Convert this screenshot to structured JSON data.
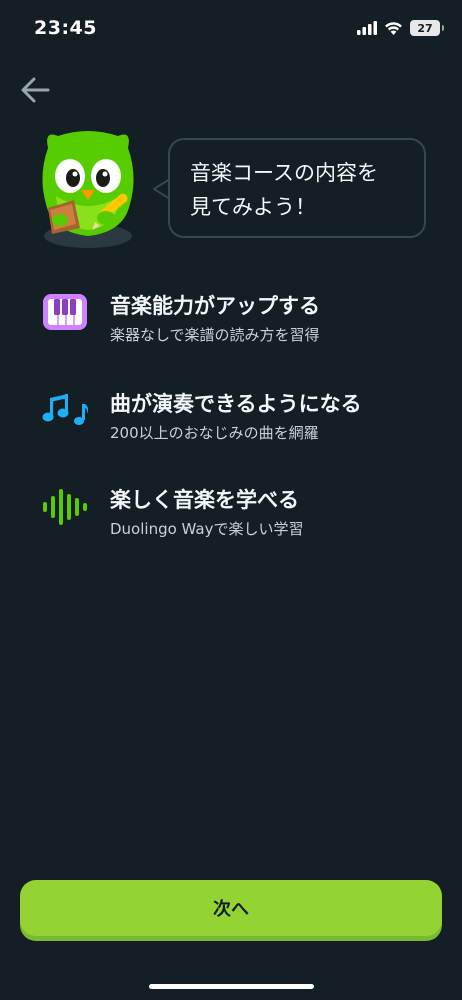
{
  "status_bar": {
    "time": "23:45",
    "battery_level": "27",
    "icons": [
      "cellular-signal-icon",
      "wifi-icon",
      "battery-icon"
    ]
  },
  "header": {
    "back_icon": "arrow-left-icon"
  },
  "mascot": {
    "icon": "duo-owl-mascot-icon"
  },
  "speech_bubble": {
    "line1": "音楽コースの内容を",
    "line2": "見てみよう！"
  },
  "features": [
    {
      "icon": "piano-keys-icon",
      "title": "音楽能力がアップする",
      "subtitle": "楽器なしで楽譜の読み方を習得"
    },
    {
      "icon": "music-notes-icon",
      "title": "曲が演奏できるようになる",
      "subtitle": "200以上のおなじみの曲を網羅"
    },
    {
      "icon": "sound-wave-icon",
      "title": "楽しく音楽を学べる",
      "subtitle": "Duolingo Wayで楽しい学習"
    }
  ],
  "footer": {
    "next_label": "次へ"
  },
  "colors": {
    "background": "#131f24",
    "primary_button": "#93d333",
    "piano_purple": "#ce82ff",
    "notes_blue": "#1cb0f6",
    "wave_green": "#58cc02"
  }
}
